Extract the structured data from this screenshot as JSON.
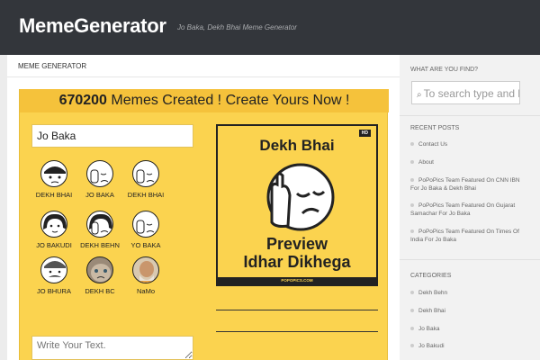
{
  "header": {
    "site_title": "MemeGenerator",
    "site_description": "Jo Baka, Dekh Bhai Meme Generator"
  },
  "main": {
    "section_title": "MEME GENERATOR",
    "banner": {
      "count": "670200",
      "text": "Memes Created ! Create Yours Now !"
    },
    "text_input": {
      "value": "Jo Baka"
    },
    "faces": [
      {
        "label": "DEKH BHAI",
        "icon": "cap-face-icon"
      },
      {
        "label": "JO BAKA",
        "icon": "facepalm-face-icon"
      },
      {
        "label": "DEKH BHAI",
        "icon": "facepalm-face-icon"
      },
      {
        "label": "JO BAKUDI",
        "icon": "girl-face-icon"
      },
      {
        "label": "DEKH BEHN",
        "icon": "girl-facepalm-icon"
      },
      {
        "label": "YO BAKA",
        "icon": "facepalm-face-icon"
      },
      {
        "label": "JO BHURA",
        "icon": "mustache-face-icon"
      },
      {
        "label": "DEKH BC",
        "icon": "grumpy-cat-icon"
      },
      {
        "label": "NaMo",
        "icon": "modi-photo-icon"
      }
    ],
    "preview": {
      "badge": "HD",
      "title": "Dekh Bhai",
      "line1": "Preview",
      "line2": "Idhar Dikhega",
      "logo": "POPOPICS.COM"
    },
    "write_text": {
      "placeholder": "Write Your Text."
    }
  },
  "sidebar": {
    "search_heading": "WHAT ARE YOU FIND?",
    "search_placeholder": "To search type and hit",
    "recent_heading": "RECENT POSTS",
    "recent_posts": [
      "Contact Us",
      "About",
      "PoPoPics Team Featured On CNN IBN For Jo Baka & Dekh Bhai",
      "PoPoPics Team Featured On Gujarat Samachar For Jo Baka",
      "PoPoPics Team Featured On Times Of India For Jo Baka"
    ],
    "categories_heading": "CATEGORIES",
    "categories": [
      "Dekh Behn",
      "Dekh Bhai",
      "Jo Baka",
      "Jo Bakudi"
    ]
  },
  "colors": {
    "topbar": "#33363b",
    "panel_yellow": "#fbd34f",
    "banner_yellow": "#f5c23b"
  }
}
